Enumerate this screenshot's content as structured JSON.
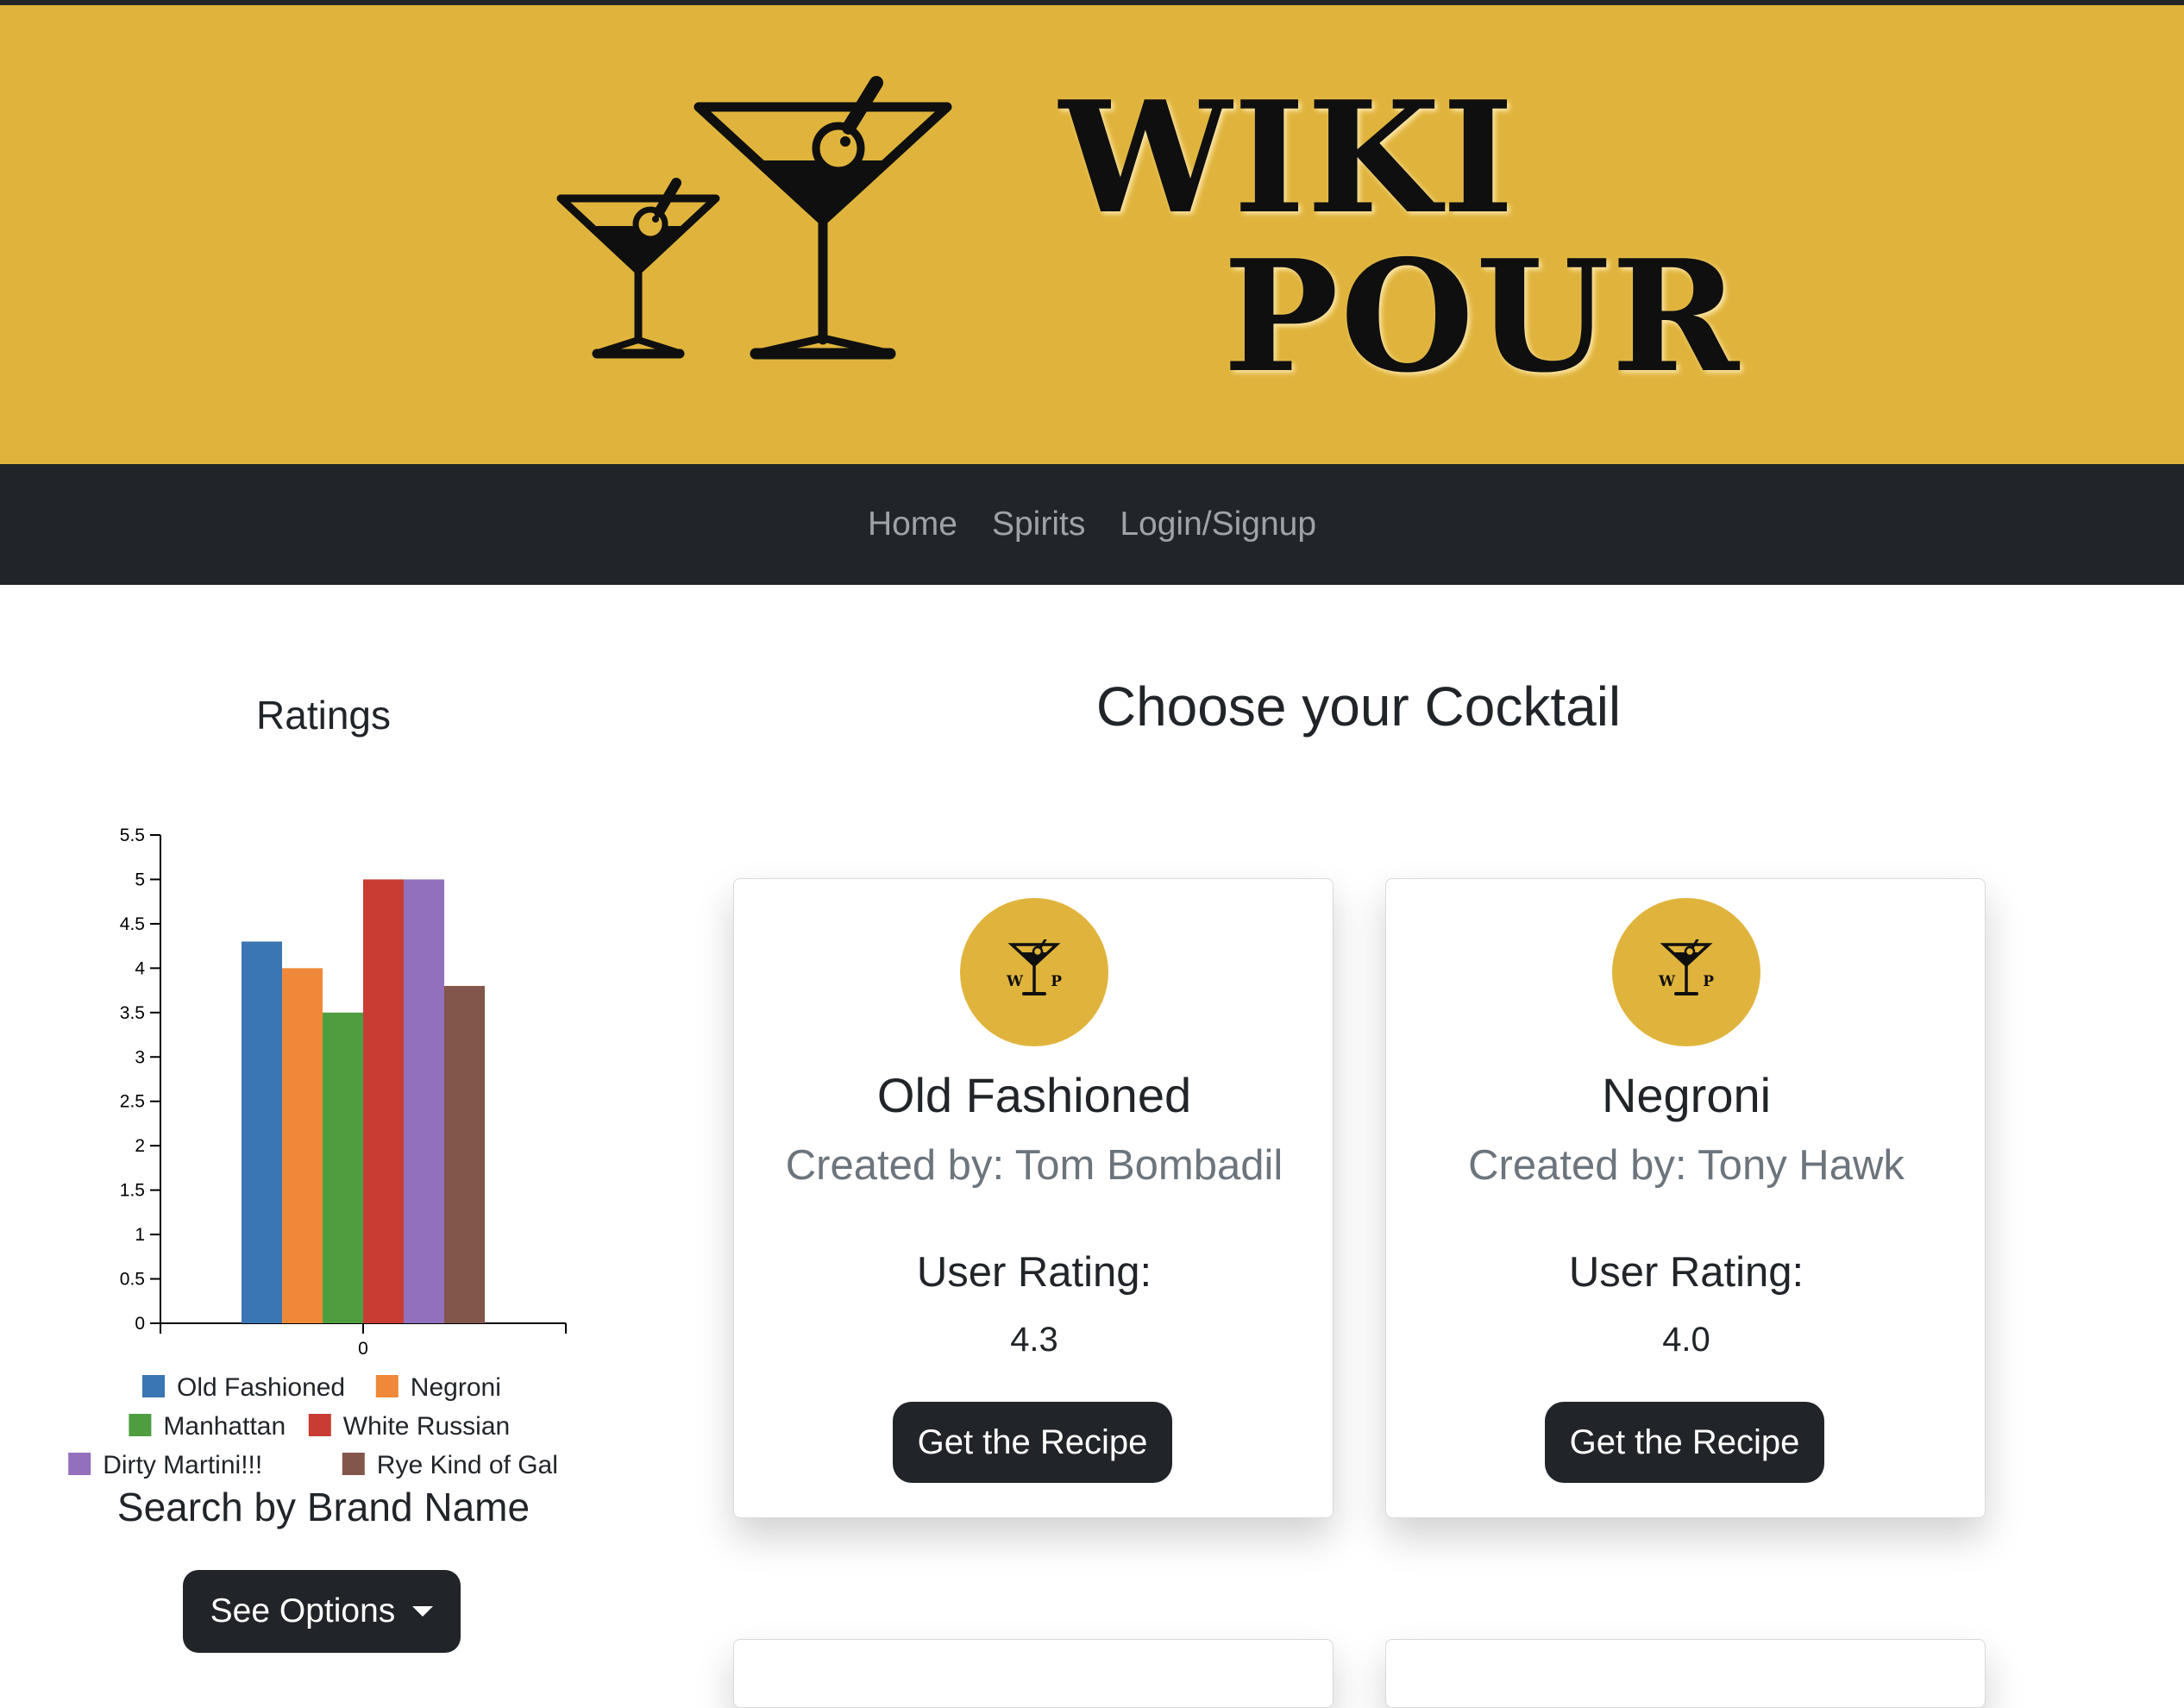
{
  "brand": {
    "line1": "WIKI",
    "line2": "POUR"
  },
  "nav": {
    "items": [
      {
        "label": "Home"
      },
      {
        "label": "Spirits"
      },
      {
        "label": "Login/Signup"
      }
    ]
  },
  "chart_data": {
    "type": "bar",
    "title": "Ratings",
    "categories": [
      "0"
    ],
    "series": [
      {
        "name": "Old Fashioned",
        "values": [
          4.3
        ],
        "color": "#3a76b4"
      },
      {
        "name": "Negroni",
        "values": [
          4.0
        ],
        "color": "#ef8838"
      },
      {
        "name": "Manhattan",
        "values": [
          3.5
        ],
        "color": "#4e9e40"
      },
      {
        "name": "White Russian",
        "values": [
          5.0
        ],
        "color": "#c83c33"
      },
      {
        "name": "Dirty Martini!!!",
        "values": [
          5.0
        ],
        "color": "#9270bd"
      },
      {
        "name": "Rye Kind of Gal",
        "values": [
          3.8
        ],
        "color": "#83564b"
      }
    ],
    "ylim": [
      0,
      5.5
    ],
    "yticks": [
      "0",
      "0.5",
      "1",
      "1.5",
      "2",
      "2.5",
      "3",
      "3.5",
      "4",
      "4.5",
      "5",
      "5.5"
    ],
    "xlabel": "",
    "ylabel": "",
    "grid": false,
    "legend_placement": "bottom"
  },
  "search": {
    "title": "Search by Brand Name",
    "button_label": "See Options"
  },
  "main": {
    "title": "Choose your Cocktail",
    "cards": [
      {
        "name": "Old Fashioned",
        "creator": "Created by: Tom Bombadil",
        "rating_label": "User Rating:",
        "rating": "4.3",
        "button_label": "Get the Recipe",
        "badge_letters": "WP"
      },
      {
        "name": "Negroni",
        "creator": "Created by: Tony Hawk",
        "rating_label": "User Rating:",
        "rating": "4.0",
        "button_label": "Get the Recipe",
        "badge_letters": "WP"
      }
    ]
  },
  "colors": {
    "brand_gold": "#e0b43c",
    "dark": "#212529",
    "muted_text": "#6c757d",
    "nav_link": "#9ea3a8"
  },
  "icons": {
    "logo": "martini-glasses-icon",
    "badge": "martini-badge-icon",
    "caret": "caret-down-icon"
  }
}
